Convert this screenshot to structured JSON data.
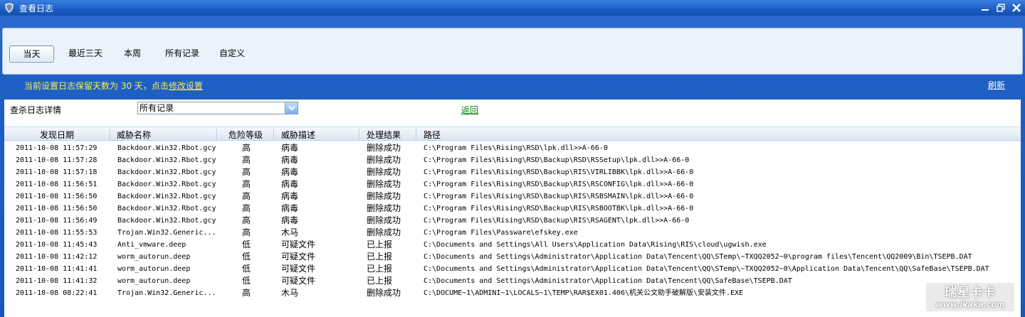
{
  "window": {
    "title": "查看日志",
    "controls": [
      "minimize-icon",
      "restore-icon",
      "close-icon"
    ]
  },
  "filters": {
    "tabs": [
      {
        "label": "当天",
        "active": true
      },
      {
        "label": "最近三天",
        "active": false
      },
      {
        "label": "本周",
        "active": false
      },
      {
        "label": "所有记录",
        "active": false
      },
      {
        "label": "自定义",
        "active": false
      }
    ]
  },
  "info": {
    "retain_prefix": "当前设置日志保留天数为 30 天，点击",
    "retain_link": "修改设置",
    "refresh": "刷新"
  },
  "detail": {
    "label": "查杀日志详情",
    "select_value": "所有记录",
    "back": "返回"
  },
  "table": {
    "columns": [
      "发现日期",
      "威胁名称",
      "危险等级",
      "威胁描述",
      "处理结果",
      "路径"
    ],
    "rows": [
      [
        "2011-10-08 11:57:29",
        "Backdoor.Win32.Rbot.gcy",
        "高",
        "病毒",
        "删除成功",
        "C:\\Program Files\\Rising\\RSD\\lpk.dll>>A-66-0"
      ],
      [
        "2011-10-08 11:57:28",
        "Backdoor.Win32.Rbot.gcy",
        "高",
        "病毒",
        "删除成功",
        "C:\\Program Files\\Rising\\RSD\\Backup\\RSD\\RSSetup\\lpk.dll>>A-66-0"
      ],
      [
        "2011-10-08 11:57:18",
        "Backdoor.Win32.Rbot.gcy",
        "高",
        "病毒",
        "删除成功",
        "C:\\Program Files\\Rising\\RSD\\Backup\\RIS\\VIRLIBBK\\lpk.dll>>A-66-0"
      ],
      [
        "2011-10-08 11:56:51",
        "Backdoor.Win32.Rbot.gcy",
        "高",
        "病毒",
        "删除成功",
        "C:\\Program Files\\Rising\\RSD\\Backup\\RIS\\RSCONFIG\\lpk.dll>>A-66-0"
      ],
      [
        "2011-10-08 11:56:50",
        "Backdoor.Win32.Rbot.gcy",
        "高",
        "病毒",
        "删除成功",
        "C:\\Program Files\\Rising\\RSD\\Backup\\RIS\\RSBSMAIN\\lpk.dll>>A-66-0"
      ],
      [
        "2011-10-08 11:56:50",
        "Backdoor.Win32.Rbot.gcy",
        "高",
        "病毒",
        "删除成功",
        "C:\\Program Files\\Rising\\RSD\\Backup\\RIS\\RSBOOTBK\\lpk.dll>>A-66-0"
      ],
      [
        "2011-10-08 11:56:49",
        "Backdoor.Win32.Rbot.gcy",
        "高",
        "病毒",
        "删除成功",
        "C:\\Program Files\\Rising\\RSD\\Backup\\RIS\\RSAGENT\\lpk.dll>>A-66-0"
      ],
      [
        "2011-10-08 11:55:53",
        "Trojan.Win32.Generic...",
        "高",
        "木马",
        "删除成功",
        "C:\\Program Files\\Passware\\efskey.exe"
      ],
      [
        "2011-10-08 11:45:43",
        "Anti_vmware.deep",
        "低",
        "可疑文件",
        "已上报",
        "C:\\Documents and Settings\\All Users\\Application Data\\Rising\\RIS\\cloud\\ugwish.exe"
      ],
      [
        "2011-10-08 11:42:12",
        "worm_autorun.deep",
        "低",
        "可疑文件",
        "已上报",
        "C:\\Documents and Settings\\Administrator\\Application Data\\Tencent\\QQ\\STemp\\~TXQQ2052~0\\program files\\Tencent\\QQ2009\\Bin\\TSEPB.DAT"
      ],
      [
        "2011-10-08 11:41:41",
        "worm_autorun.deep",
        "低",
        "可疑文件",
        "已上报",
        "C:\\Documents and Settings\\Administrator\\Application Data\\Tencent\\QQ\\STemp\\~TXQQ2052~0\\Application Data\\Tencent\\QQ\\SafeBase\\TSEPB.DAT"
      ],
      [
        "2011-10-08 11:41:32",
        "worm_autorun.deep",
        "低",
        "可疑文件",
        "已上报",
        "C:\\Documents and Settings\\Administrator\\Application Data\\Tencent\\QQ\\SafeBase\\TSEPB.DAT"
      ],
      [
        "2011-10-08 08:22:41",
        "Trojan.Win32.Generic...",
        "高",
        "木马",
        "删除成功",
        "C:\\DOCUME~1\\ADMINI~1\\LOCALS~1\\TEMP\\RAR$EX01.406\\机关公文助手破解版\\安装文件.EXE"
      ]
    ]
  },
  "watermark": {
    "top": "瑞星卡卡",
    "bottom": "www.ikaka.com"
  },
  "colors": {
    "titlebar": "#1b5cc4",
    "panel": "#eaf3fb",
    "notice_text": "#f2f256",
    "back_link": "#0a7a0a"
  }
}
